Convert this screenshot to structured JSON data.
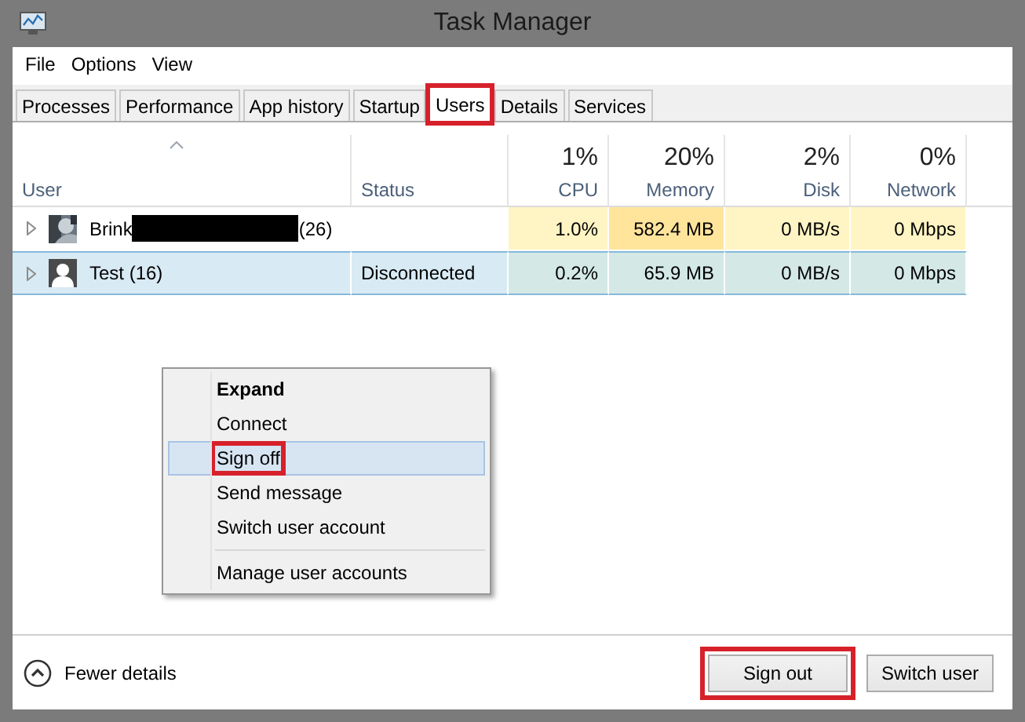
{
  "window": {
    "title": "Task Manager"
  },
  "menu_bar": [
    "File",
    "Options",
    "View"
  ],
  "tabs": [
    {
      "label": "Processes",
      "selected": false,
      "highlighted": false
    },
    {
      "label": "Performance",
      "selected": false,
      "highlighted": false
    },
    {
      "label": "App history",
      "selected": false,
      "highlighted": false
    },
    {
      "label": "Startup",
      "selected": false,
      "highlighted": false
    },
    {
      "label": "Users",
      "selected": true,
      "highlighted": true
    },
    {
      "label": "Details",
      "selected": false,
      "highlighted": false
    },
    {
      "label": "Services",
      "selected": false,
      "highlighted": false
    }
  ],
  "table": {
    "columns": [
      {
        "label": "User",
        "sorted": true
      },
      {
        "label": "Status",
        "sorted": false
      },
      {
        "label": "CPU",
        "total": "1%",
        "sorted": false
      },
      {
        "label": "Memory",
        "total": "20%",
        "sorted": false
      },
      {
        "label": "Disk",
        "total": "2%",
        "sorted": false
      },
      {
        "label": "Network",
        "total": "0%",
        "sorted": false
      }
    ],
    "rows": [
      {
        "selected": false,
        "cells": [
          {
            "kind": "user",
            "name": "Brink",
            "redacted": true,
            "suffix": "(26)"
          },
          {
            "kind": "text"
          },
          {
            "kind": "metric",
            "value": "1.0%",
            "color": "#fff4c4"
          },
          {
            "kind": "metric",
            "value": "582.4 MB",
            "color": "#ffe49c"
          },
          {
            "kind": "metric",
            "value": "0 MB/s",
            "color": "#fff4c4"
          },
          {
            "kind": "metric",
            "value": "0 Mbps",
            "color": "#fff4c4"
          }
        ]
      },
      {
        "selected": true,
        "cells": [
          {
            "kind": "user",
            "name": "Test (16)",
            "redacted": false,
            "avatar": {
              "kind": "generic"
            }
          },
          {
            "kind": "text",
            "value": "Disconnected"
          },
          {
            "kind": "metric",
            "value": "0.2%",
            "color": "#d4e9e6"
          },
          {
            "kind": "metric",
            "value": "65.9 MB",
            "color": "#d4e9e6"
          },
          {
            "kind": "metric",
            "value": "0 MB/s",
            "color": "#d4e9e6"
          },
          {
            "kind": "metric",
            "value": "0 Mbps",
            "color": "#d4e9e6"
          }
        ]
      }
    ]
  },
  "context_menu": {
    "items": [
      {
        "kind": "item",
        "label": "Expand",
        "default": true,
        "selected": false,
        "highlighted": false
      },
      {
        "kind": "item",
        "label": "Connect",
        "default": false,
        "selected": false,
        "highlighted": false
      },
      {
        "kind": "item",
        "label": "Sign off",
        "default": false,
        "selected": true,
        "highlighted": true
      },
      {
        "kind": "item",
        "label": "Send message",
        "default": false,
        "selected": false,
        "highlighted": false
      },
      {
        "kind": "item",
        "label": "Switch user account",
        "default": false,
        "selected": false,
        "highlighted": false
      },
      {
        "kind": "separator"
      },
      {
        "kind": "item",
        "label": "Manage user accounts",
        "default": false,
        "selected": false,
        "highlighted": false
      }
    ]
  },
  "footer": {
    "toggle": "Fewer details",
    "buttons": [
      {
        "label": "Sign out",
        "highlighted": true
      },
      {
        "label": "Switch user",
        "highlighted": false
      }
    ]
  }
}
